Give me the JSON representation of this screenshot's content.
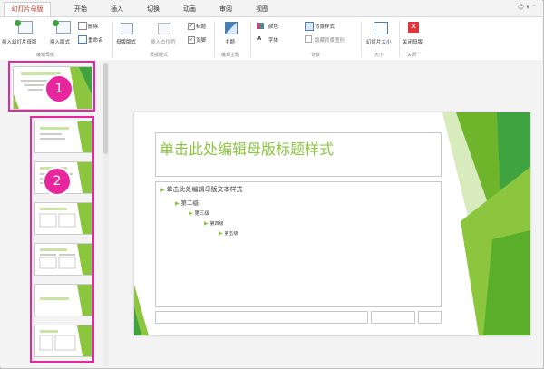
{
  "tabs": [
    "幻灯片母版",
    "开始",
    "插入",
    "切换",
    "动画",
    "审阅",
    "视图"
  ],
  "ribbon": {
    "insert_master": "插入幻灯片母版",
    "insert_layout": "插入版式",
    "delete": "删除",
    "rename": "重命名",
    "master_layout": "母版版式",
    "insert_placeholder": "插入占位符",
    "title": "标题",
    "footer": "页脚",
    "theme": "主题",
    "colors": "颜色",
    "fonts": "字体",
    "bg_styles": "背景样式",
    "hide_bg": "隐藏背景图形",
    "slide_size": "幻灯片大小",
    "close_master": "关闭母版",
    "group_edit_master": "编辑母版",
    "group_master_layout": "母版版式",
    "group_edit_theme": "编辑主题",
    "group_background": "背景",
    "group_size": "大小",
    "group_close": "关闭"
  },
  "badges": [
    "1",
    "2"
  ],
  "slide": {
    "title": "单击此处编辑母版标题样式",
    "levels": [
      "单击此处编辑母版文本样式",
      "第二级",
      "第三级",
      "第四级",
      "第五级"
    ]
  },
  "colors": {
    "accent_green": "#8cc63f",
    "highlight_pink": "#e8279e",
    "close_red": "#e0333a"
  }
}
